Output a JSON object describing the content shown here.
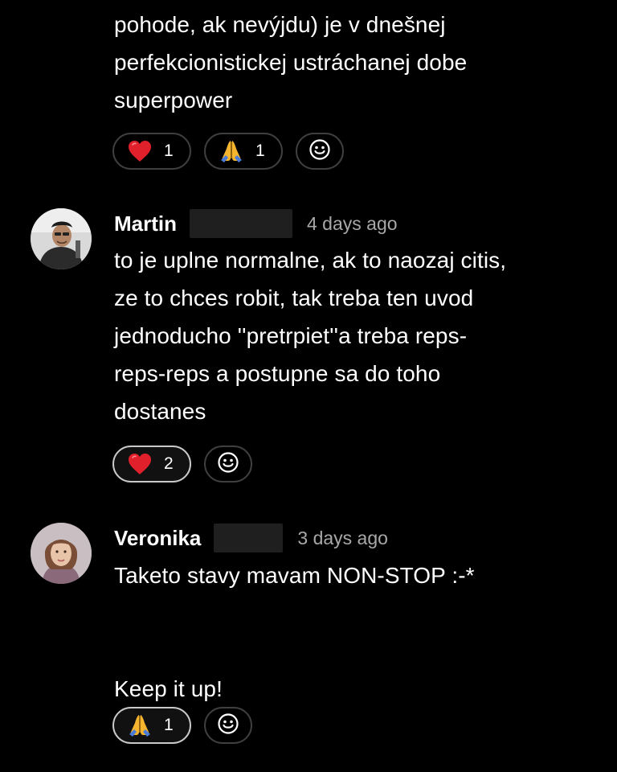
{
  "comment_top": {
    "lines": [
      "pohode, ak nevýjdu) je v dnešnej",
      "perfekcionistickej ustráchanej dobe",
      "superpower"
    ],
    "reactions": [
      {
        "icon": "heart-icon",
        "count": "1"
      },
      {
        "icon": "folded-hands-icon",
        "count": "1"
      }
    ]
  },
  "comment_martin": {
    "author": "Martin",
    "timestamp": "4 days ago",
    "lines": [
      "to je uplne normalne, ak to naozaj citis,",
      "ze to chces robit, tak treba ten uvod",
      "jednoducho ''pretrpiet''a treba reps-",
      "reps-reps a postupne sa do toho",
      "dostanes"
    ],
    "reactions": [
      {
        "icon": "heart-icon",
        "count": "2"
      }
    ]
  },
  "comment_veronika": {
    "author": "Veronika",
    "timestamp": "3 days ago",
    "lines": [
      "Taketo stavy mavam NON-STOP :-*",
      "",
      "Keep it up!"
    ],
    "reactions": [
      {
        "icon": "folded-hands-icon",
        "count": "1"
      }
    ]
  },
  "colors": {
    "background": "#000000",
    "text": "#ffffff",
    "muted": "#a8a8a8",
    "pill_border": "#3f3f3f",
    "pill_border_active": "#c9c9c9",
    "heart": "#e0202b",
    "hands": "#f5b52e"
  }
}
